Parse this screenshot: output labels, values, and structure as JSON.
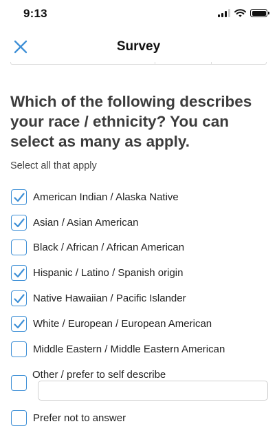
{
  "status_bar": {
    "time": "9:13"
  },
  "nav": {
    "title": "Survey",
    "close_icon": "close-x-icon"
  },
  "question": {
    "text": "Which of the following describes your race / ethnicity? You can select as many as apply.",
    "hint": "Select all that apply"
  },
  "options": [
    {
      "label": "American Indian / Alaska Native",
      "checked": true
    },
    {
      "label": "Asian / Asian American",
      "checked": true
    },
    {
      "label": "Black / African / African American",
      "checked": false
    },
    {
      "label": "Hispanic / Latino / Spanish origin",
      "checked": true
    },
    {
      "label": "Native Hawaiian / Pacific Islander",
      "checked": true
    },
    {
      "label": "White / European / European American",
      "checked": true
    },
    {
      "label": "Middle Eastern / Middle Eastern American",
      "checked": false
    }
  ],
  "other": {
    "label": "Other / prefer to self describe",
    "checked": false,
    "value": "",
    "placeholder": ""
  },
  "prefer_not": {
    "label": "Prefer not to answer",
    "checked": false
  },
  "colors": {
    "accent": "#3d8fd6",
    "title": "#3c3c3c"
  }
}
